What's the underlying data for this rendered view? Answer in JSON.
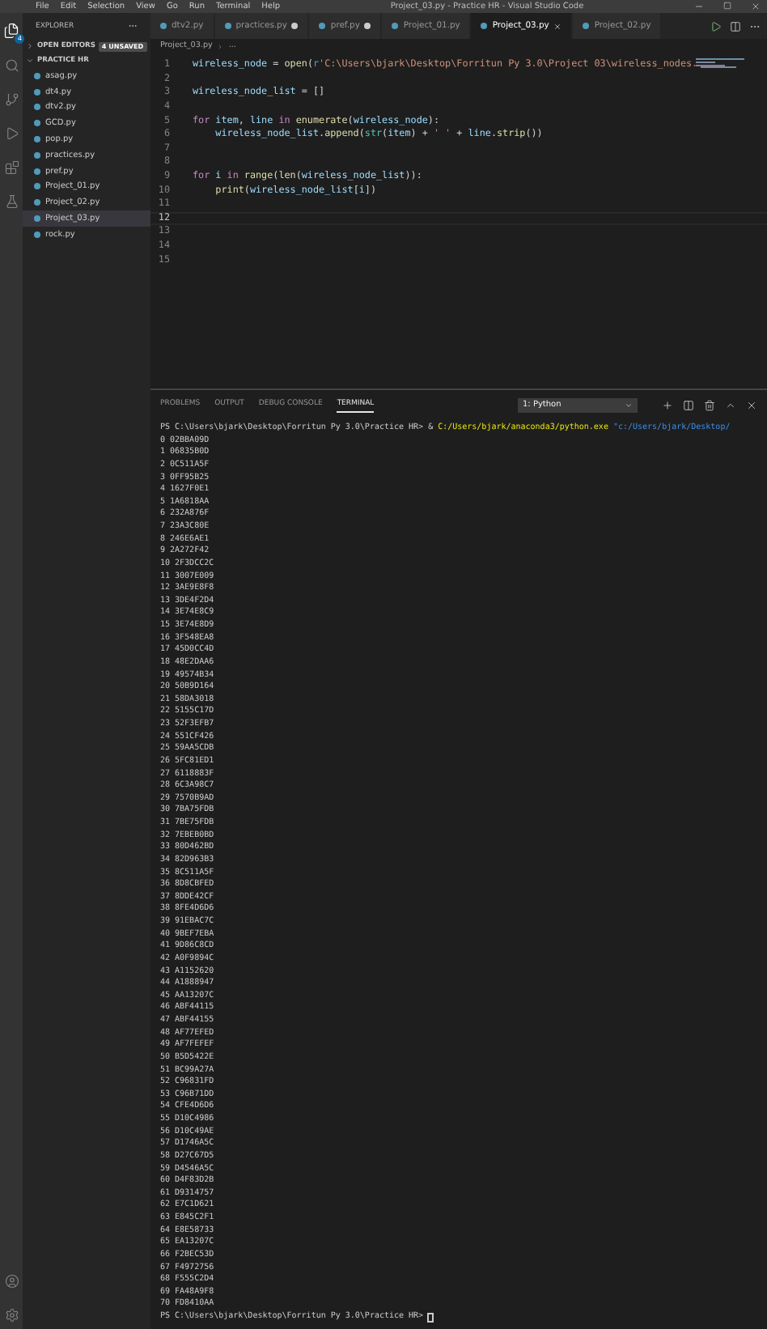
{
  "title_bar": {
    "menu": [
      "File",
      "Edit",
      "Selection",
      "View",
      "Go",
      "Run",
      "Terminal",
      "Help"
    ],
    "title": "Project_03.py - Practice HR - Visual Studio Code"
  },
  "activity_bar": {
    "explorer_badge": "4"
  },
  "sidebar": {
    "title": "EXPLORER",
    "sections": [
      {
        "label": "OPEN EDITORS",
        "expanded": false,
        "badge": "4 UNSAVED"
      },
      {
        "label": "PRACTICE HR",
        "expanded": true,
        "files": [
          {
            "name": "asag.py",
            "selected": false
          },
          {
            "name": "dt4.py",
            "selected": false
          },
          {
            "name": "dtv2.py",
            "selected": false
          },
          {
            "name": "GCD.py",
            "selected": false
          },
          {
            "name": "pop.py",
            "selected": false
          },
          {
            "name": "practices.py",
            "selected": false
          },
          {
            "name": "pref.py",
            "selected": false
          },
          {
            "name": "Project_01.py",
            "selected": false
          },
          {
            "name": "Project_02.py",
            "selected": false
          },
          {
            "name": "Project_03.py",
            "selected": true
          },
          {
            "name": "rock.py",
            "selected": false
          }
        ]
      }
    ]
  },
  "tabs": [
    {
      "label": "dtv2.py",
      "selected": false,
      "modified": false
    },
    {
      "label": "practices.py",
      "selected": false,
      "modified": true
    },
    {
      "label": "pref.py",
      "selected": false,
      "modified": true
    },
    {
      "label": "Project_01.py",
      "selected": false,
      "modified": false
    },
    {
      "label": "Project_03.py",
      "selected": true,
      "modified": false
    },
    {
      "label": "Project_02.py",
      "selected": false,
      "modified": false
    }
  ],
  "breadcrumb": [
    "Project_03.py",
    "..."
  ],
  "editor": {
    "lines": [
      {
        "number": "1",
        "current": false,
        "tokens": [
          {
            "kind": "var",
            "text": "wireless_node"
          },
          {
            "kind": "plain",
            "text": " = "
          },
          {
            "kind": "fn",
            "text": "open"
          },
          {
            "kind": "plain",
            "text": "("
          },
          {
            "kind": "kw",
            "text": "r"
          },
          {
            "kind": "str",
            "text": "'C:\\Users\\bjark\\Desktop\\Forritun Py 3.0\\Project 03\\wireless_nodes."
          }
        ]
      },
      {
        "number": "2",
        "current": false
      },
      {
        "number": "3",
        "current": false,
        "tokens": [
          {
            "kind": "var",
            "text": "wireless_node_list"
          },
          {
            "kind": "plain",
            "text": " = []"
          }
        ]
      },
      {
        "number": "4",
        "current": false
      },
      {
        "number": "5",
        "current": false,
        "tokens": [
          {
            "kind": "ctl",
            "text": "for"
          },
          {
            "kind": "var",
            "text": " item"
          },
          {
            "kind": "plain",
            "text": ", "
          },
          {
            "kind": "var",
            "text": "line"
          },
          {
            "kind": "ctl",
            "text": " in"
          },
          {
            "kind": "fn",
            "text": " enumerate"
          },
          {
            "kind": "plain",
            "text": "("
          },
          {
            "kind": "var",
            "text": "wireless_node"
          },
          {
            "kind": "plain",
            "text": "):"
          }
        ]
      },
      {
        "number": "6",
        "current": false,
        "tokens": [
          {
            "kind": "var",
            "text": "    wireless_node_list"
          },
          {
            "kind": "plain",
            "text": "."
          },
          {
            "kind": "fn",
            "text": "append"
          },
          {
            "kind": "plain",
            "text": "("
          },
          {
            "kind": "type",
            "text": "str"
          },
          {
            "kind": "plain",
            "text": "("
          },
          {
            "kind": "var",
            "text": "item"
          },
          {
            "kind": "plain",
            "text": ") + "
          },
          {
            "kind": "str",
            "text": "' '"
          },
          {
            "kind": "plain",
            "text": " + "
          },
          {
            "kind": "var",
            "text": "line"
          },
          {
            "kind": "plain",
            "text": "."
          },
          {
            "kind": "fn",
            "text": "strip"
          },
          {
            "kind": "plain",
            "text": "())"
          }
        ]
      },
      {
        "number": "7",
        "current": false
      },
      {
        "number": "8",
        "current": false
      },
      {
        "number": "9",
        "current": false,
        "tokens": [
          {
            "kind": "ctl",
            "text": "for"
          },
          {
            "kind": "var",
            "text": " i"
          },
          {
            "kind": "ctl",
            "text": " in"
          },
          {
            "kind": "fn",
            "text": " range"
          },
          {
            "kind": "plain",
            "text": "("
          },
          {
            "kind": "fn",
            "text": "len"
          },
          {
            "kind": "plain",
            "text": "("
          },
          {
            "kind": "var",
            "text": "wireless_node_list"
          },
          {
            "kind": "plain",
            "text": ")):"
          }
        ]
      },
      {
        "number": "10",
        "current": false,
        "tokens": [
          {
            "kind": "fn",
            "text": "    print"
          },
          {
            "kind": "plain",
            "text": "("
          },
          {
            "kind": "var",
            "text": "wireless_node_list"
          },
          {
            "kind": "plain",
            "text": "["
          },
          {
            "kind": "var",
            "text": "i"
          },
          {
            "kind": "plain",
            "text": "])"
          }
        ]
      },
      {
        "number": "11",
        "current": false
      },
      {
        "number": "12",
        "current": true
      },
      {
        "number": "13",
        "current": false
      },
      {
        "number": "14",
        "current": false
      },
      {
        "number": "15",
        "current": false
      }
    ]
  },
  "panel": {
    "tabs": [
      {
        "label": "PROBLEMS",
        "selected": false
      },
      {
        "label": "OUTPUT",
        "selected": false
      },
      {
        "label": "DEBUG CONSOLE",
        "selected": false
      },
      {
        "label": "TERMINAL",
        "selected": true
      }
    ],
    "terminal_select": "1: Python",
    "command": {
      "prompt": "PS C:\\Users\\bjark\\Desktop\\Forritun Py 3.0\\Practice HR> & ",
      "exe": "C:/Users/bjark/anaconda3/python.exe",
      "arg": " \"c:/Users/bjark/Desktop/"
    },
    "output": [
      "0 02BBA09D",
      "1 06835B0D",
      "2 0C511A5F",
      "3 0FF95B25",
      "4 1627F0E1",
      "5 1A6818AA",
      "6 232A876F",
      "7 23A3C80E",
      "8 246E6AE1",
      "9 2A272F42",
      "10 2F3DCC2C",
      "11 3007E009",
      "12 3AE9E8F8",
      "13 3DE4F2D4",
      "14 3E74E8C9",
      "15 3E74E8D9",
      "16 3F548EA8",
      "17 45D0CC4D",
      "18 48E2DAA6",
      "19 49574B34",
      "20 50B9D164",
      "21 58DA3018",
      "22 5155C17D",
      "23 52F3EFB7",
      "24 551CF426",
      "25 59AA5CDB",
      "26 5FC81ED1",
      "27 6118883F",
      "28 6C3A98C7",
      "29 7570B9AD",
      "30 7BA75FDB",
      "31 7BE75FDB",
      "32 7EBEB0BD",
      "33 80D462BD",
      "34 82D963B3",
      "35 8C511A5F",
      "36 8D8CBFED",
      "37 8DDE42CF",
      "38 8FE4D6D6",
      "39 91EBAC7C",
      "40 9BEF7EBA",
      "41 9D86C8CD",
      "42 A0F9894C",
      "43 A1152620",
      "44 A1888947",
      "45 AA13207C",
      "46 ABF44115",
      "47 ABF44155",
      "48 AF77EFED",
      "49 AF7FEFEF",
      "50 B5D5422E",
      "51 BC99A27A",
      "52 C96831FD",
      "53 C96B71DD",
      "54 CFE4D6D6",
      "55 D10C4986",
      "56 D10C49AE",
      "57 D1746A5C",
      "58 D27C67D5",
      "59 D4546A5C",
      "60 D4F83D2B",
      "61 D9314757",
      "62 E7C1D621",
      "63 E845C2F1",
      "64 E8E58733",
      "65 EA13207C",
      "66 F2BEC53D",
      "67 F4972756",
      "68 F555C2D4",
      "69 FA48A9F8",
      "70 FD8410AA"
    ],
    "final_prompt": "PS C:\\Users\\bjark\\Desktop\\Forritun Py 3.0\\Practice HR>"
  }
}
